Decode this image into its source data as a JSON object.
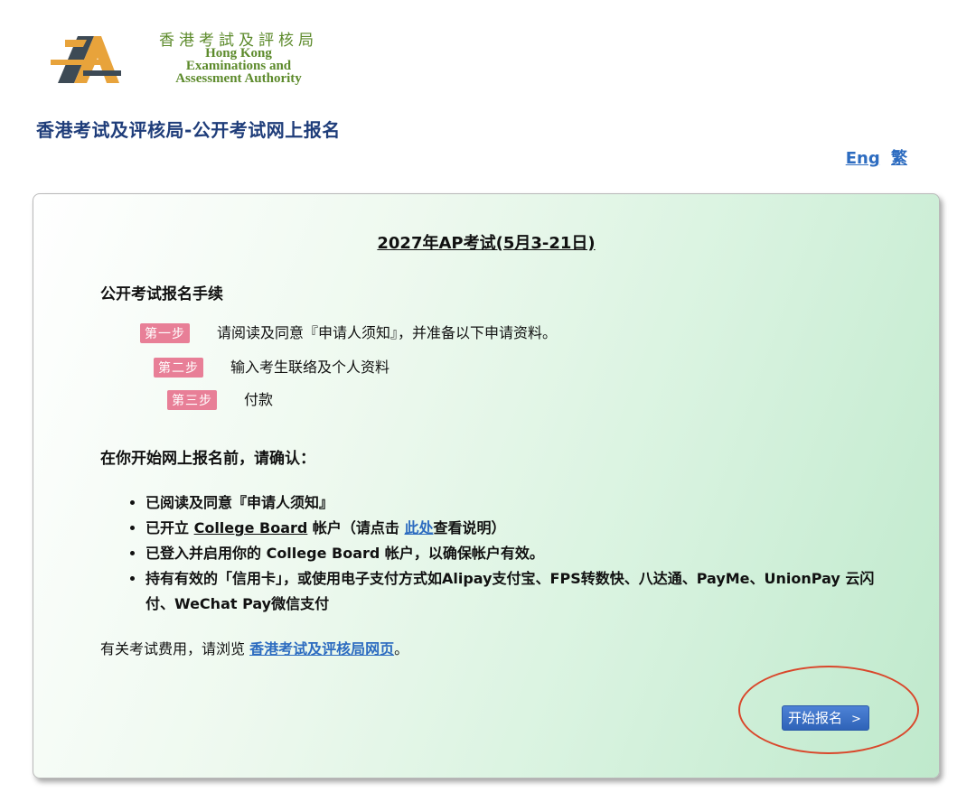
{
  "logo": {
    "chinese": "香港考試及評核局",
    "english_lines": [
      "Hong Kong",
      "Examinations and",
      "Assessment Authority"
    ]
  },
  "page_title": "香港考试及评核局-公开考试网上报名",
  "lang": {
    "eng": "Eng",
    "trad": "繁"
  },
  "card": {
    "exam_title": "2027年AP考试(5月3-21日)",
    "procedure_heading": "公开考试报名手续",
    "steps": [
      {
        "badge": "第一步",
        "text": "请阅读及同意『申请人须知』，并准备以下申请资料。"
      },
      {
        "badge": "第二步",
        "text": "输入考生联络及个人资料"
      },
      {
        "badge": "第三步",
        "text": "付款"
      }
    ],
    "confirm_heading": "在你开始网上报名前，请确认：",
    "checklist": {
      "item1": "已阅读及同意『申请人须知』",
      "item2_pre": "已开立 ",
      "item2_link": "College Board",
      "item2_mid": " 帐户（请点击 ",
      "item2_link2": "此处",
      "item2_post": "查看说明）",
      "item3": "已登入并启用你的 College Board 帐户，以确保帐户有效。",
      "item4": "持有有效的「信用卡」，或使用电子支付方式如Alipay支付宝、FPS转数快、八达通、PayMe、UnionPay 云闪付、WeChat Pay微信支付"
    },
    "fees_pre": "有关考试费用，请浏览 ",
    "fees_link": "香港考试及评核局网页",
    "fees_post": "。",
    "start_button": "开始报名",
    "start_chevron": ">"
  },
  "colors": {
    "title": "#1f3d7a",
    "link": "#2d6cc0",
    "step_badge": "#e87f97",
    "button": "#3b6fc4",
    "highlight": "#d9472b",
    "logo_green": "#5c8a2b",
    "logo_orange": "#e8a33b"
  }
}
